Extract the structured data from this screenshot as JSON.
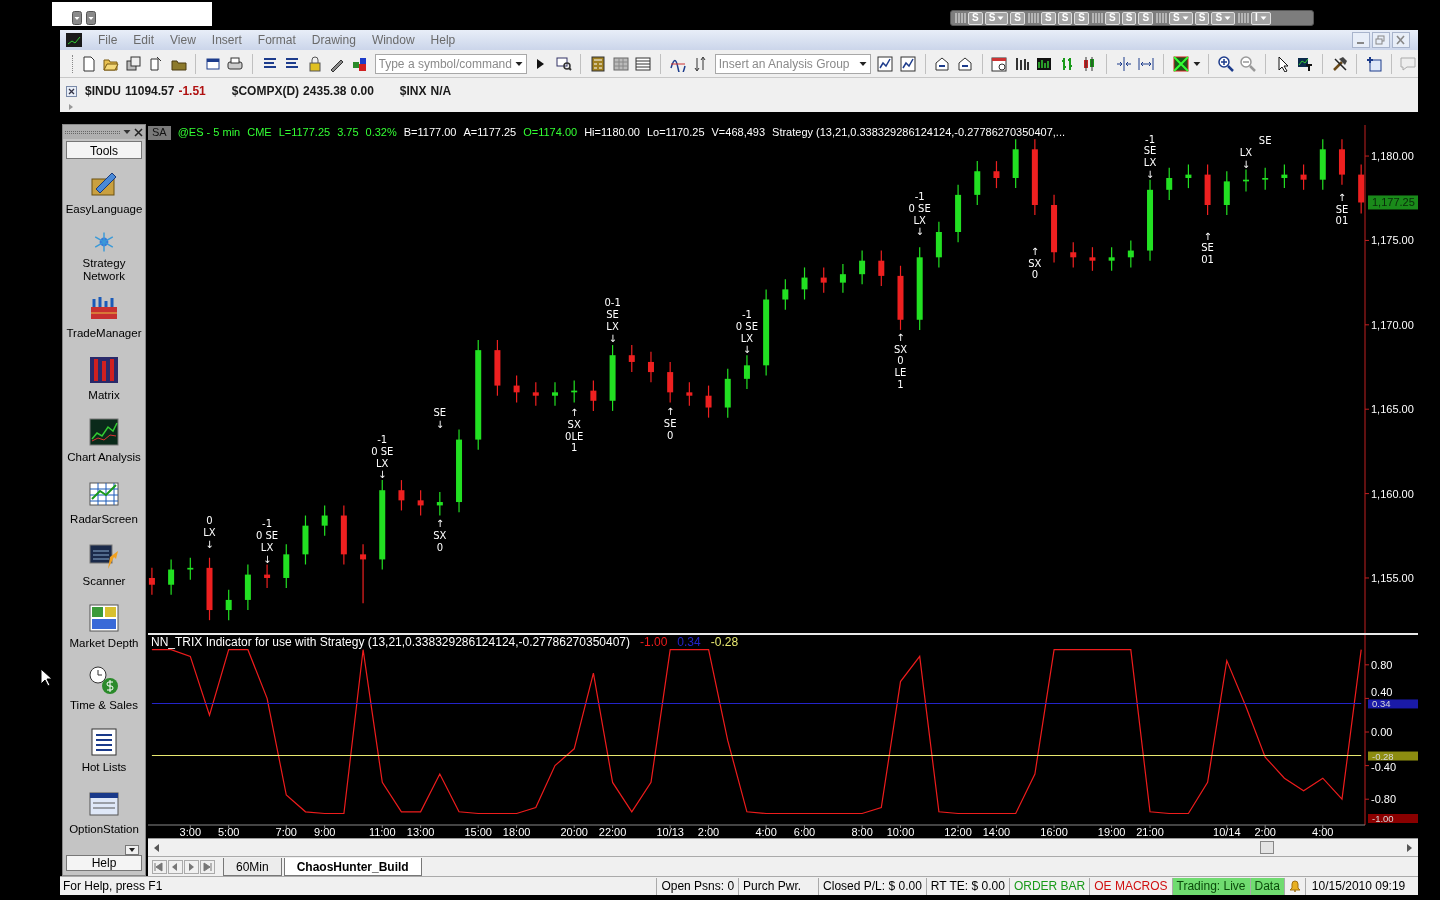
{
  "top_strip": {
    "buttons": [
      {
        "label": "S",
        "menu": false
      },
      {
        "label": "S",
        "menu": true
      },
      {
        "label": "S",
        "menu": false
      },
      {
        "label": "S",
        "menu": false
      },
      {
        "label": "S",
        "menu": false
      },
      {
        "label": "S",
        "menu": false
      },
      {
        "label": "S",
        "menu": false
      },
      {
        "label": "S",
        "menu": false
      },
      {
        "label": "S",
        "menu": false
      },
      {
        "label": "S",
        "menu": true
      },
      {
        "label": "S",
        "menu": false
      },
      {
        "label": "S",
        "menu": true
      },
      {
        "label": "I",
        "menu": true
      }
    ]
  },
  "window": {
    "menu": [
      "File",
      "Edit",
      "View",
      "Insert",
      "Format",
      "Drawing",
      "Window",
      "Help"
    ]
  },
  "toolbar": {
    "symbol_field": {
      "placeholder": "Type a symbol/command"
    },
    "analysis_field": {
      "placeholder": "Insert an Analysis Group"
    }
  },
  "quote_bar": [
    {
      "symbol": "$INDU",
      "last": "11094.57",
      "change": "-1.51",
      "color": "#b01010"
    },
    {
      "symbol": "$COMPX(D)",
      "last": "2435.38",
      "change": "0.00",
      "color": "#1a1a1a"
    },
    {
      "symbol": "$INX",
      "last": "N/A"
    }
  ],
  "tools_panel": {
    "title": "Tools",
    "items": [
      "EasyLanguage",
      "Strategy Network",
      "TradeManager",
      "Matrix",
      "Chart Analysis",
      "RadarScreen",
      "Scanner",
      "Market Depth",
      "Time & Sales",
      "Hot Lists",
      "OptionStation"
    ],
    "footer": "Help"
  },
  "chart": {
    "badge": "SA",
    "legend": [
      {
        "text": "@ES - 5 min",
        "color": "#33ff33"
      },
      {
        "text": "CME",
        "color": "#33ff33"
      },
      {
        "text": "L=1177.25",
        "color": "#33ff33"
      },
      {
        "text": "3.75",
        "color": "#33ff33"
      },
      {
        "text": "0.32%",
        "color": "#33ff33"
      },
      {
        "text": "B=1177.00",
        "color": "#ffffff"
      },
      {
        "text": "A=1177.25",
        "color": "#ffffff"
      },
      {
        "text": "O=1174.00",
        "color": "#33ff33"
      },
      {
        "text": "Hi=1180.00",
        "color": "#ffffff"
      },
      {
        "text": "Lo=1170.25",
        "color": "#ffffff"
      },
      {
        "text": "V=468,493",
        "color": "#ffffff"
      },
      {
        "text": "Strategy (13,21,0.338329286124124,-0.27786270350407,...",
        "color": "#ffffff"
      }
    ],
    "last_price_tag": "1,177.25",
    "chart_data": {
      "type": "candlestick",
      "ylim": [
        1151.74,
        1181.84
      ],
      "categories": [
        null,
        null,
        null,
        null,
        null,
        null,
        null,
        null,
        null,
        null,
        null,
        null,
        null,
        null,
        null,
        null,
        null,
        null,
        null,
        null,
        null,
        null,
        null,
        null,
        null,
        null,
        null,
        null,
        null,
        null,
        null,
        null,
        null,
        null,
        null,
        null,
        null,
        null,
        null,
        null,
        null,
        null,
        null,
        null,
        null,
        null,
        null,
        null,
        null,
        null,
        null,
        null,
        null,
        null,
        null,
        null,
        null,
        null,
        null,
        null,
        null,
        null,
        null,
        null
      ],
      "ohlc": [
        [
          1155.0,
          1155.6,
          1154.0,
          1154.6
        ],
        [
          1154.6,
          1156.1,
          1154.0,
          1155.5
        ],
        [
          1155.5,
          1156.2,
          1154.9,
          1155.6
        ],
        [
          1155.6,
          1156.2,
          1152.5,
          1153.1
        ],
        [
          1153.1,
          1154.3,
          1152.5,
          1153.7
        ],
        [
          1153.7,
          1155.8,
          1153.1,
          1155.2
        ],
        [
          1155.2,
          1155.8,
          1154.4,
          1155.0
        ],
        [
          1155.0,
          1157.0,
          1154.4,
          1156.4
        ],
        [
          1156.4,
          1158.7,
          1155.8,
          1158.1
        ],
        [
          1158.1,
          1159.3,
          1157.5,
          1158.7
        ],
        [
          1158.7,
          1159.3,
          1155.8,
          1156.4
        ],
        [
          1156.4,
          1157.0,
          1153.5,
          1156.1
        ],
        [
          1156.1,
          1160.8,
          1155.5,
          1160.2
        ],
        [
          1160.2,
          1160.8,
          1159.0,
          1159.6
        ],
        [
          1159.6,
          1160.2,
          1158.7,
          1159.3
        ],
        [
          1159.3,
          1160.1,
          1158.7,
          1159.5
        ],
        [
          1159.5,
          1163.8,
          1158.9,
          1163.2
        ],
        [
          1163.2,
          1169.1,
          1162.6,
          1168.5
        ],
        [
          1168.5,
          1169.1,
          1165.8,
          1166.4
        ],
        [
          1166.4,
          1167.0,
          1165.4,
          1166.0
        ],
        [
          1166.0,
          1166.6,
          1165.2,
          1165.8
        ],
        [
          1165.8,
          1166.6,
          1165.2,
          1166.0
        ],
        [
          1166.0,
          1166.7,
          1165.4,
          1166.1
        ],
        [
          1166.1,
          1166.7,
          1164.9,
          1165.5
        ],
        [
          1165.5,
          1168.8,
          1164.9,
          1168.2
        ],
        [
          1168.2,
          1168.8,
          1167.2,
          1167.8
        ],
        [
          1167.8,
          1168.4,
          1166.6,
          1167.2
        ],
        [
          1167.2,
          1167.8,
          1165.4,
          1166.0
        ],
        [
          1166.0,
          1166.6,
          1165.2,
          1165.8
        ],
        [
          1165.8,
          1166.4,
          1164.5,
          1165.1
        ],
        [
          1165.1,
          1167.4,
          1164.5,
          1166.8
        ],
        [
          1166.8,
          1168.2,
          1166.2,
          1167.6
        ],
        [
          1167.6,
          1172.1,
          1167.0,
          1171.5
        ],
        [
          1171.5,
          1172.7,
          1170.9,
          1172.1
        ],
        [
          1172.1,
          1173.4,
          1171.5,
          1172.8
        ],
        [
          1172.8,
          1173.4,
          1171.9,
          1172.5
        ],
        [
          1172.5,
          1173.6,
          1171.9,
          1173.0
        ],
        [
          1173.0,
          1174.4,
          1172.4,
          1173.8
        ],
        [
          1173.8,
          1174.4,
          1172.3,
          1172.9
        ],
        [
          1172.9,
          1173.5,
          1169.7,
          1170.3
        ],
        [
          1170.3,
          1174.6,
          1169.7,
          1174.0
        ],
        [
          1174.0,
          1176.1,
          1173.4,
          1175.5
        ],
        [
          1175.5,
          1178.3,
          1174.9,
          1177.7
        ],
        [
          1177.7,
          1179.7,
          1177.1,
          1179.1
        ],
        [
          1179.1,
          1179.7,
          1178.1,
          1178.7
        ],
        [
          1178.7,
          1181.0,
          1178.1,
          1180.4
        ],
        [
          1180.4,
          1181.0,
          1176.5,
          1177.1
        ],
        [
          1177.1,
          1177.7,
          1173.7,
          1174.3
        ],
        [
          1174.3,
          1174.9,
          1173.4,
          1174.0
        ],
        [
          1174.0,
          1174.6,
          1173.2,
          1173.8
        ],
        [
          1173.8,
          1174.6,
          1173.2,
          1174.0
        ],
        [
          1174.0,
          1175.0,
          1173.4,
          1174.4
        ],
        [
          1174.4,
          1178.6,
          1173.8,
          1178.0
        ],
        [
          1178.0,
          1179.3,
          1177.4,
          1178.7
        ],
        [
          1178.7,
          1179.5,
          1178.1,
          1178.9
        ],
        [
          1178.9,
          1179.5,
          1176.5,
          1177.1
        ],
        [
          1177.1,
          1179.1,
          1176.5,
          1178.5
        ],
        [
          1178.5,
          1179.2,
          1177.9,
          1178.6
        ],
        [
          1178.6,
          1179.3,
          1178.0,
          1178.7
        ],
        [
          1178.7,
          1179.5,
          1178.1,
          1178.9
        ],
        [
          1178.9,
          1179.5,
          1178.0,
          1178.6
        ],
        [
          1178.6,
          1181.0,
          1178.0,
          1180.4
        ],
        [
          1180.4,
          1181.0,
          1178.3,
          1178.9
        ],
        [
          1178.9,
          1179.5,
          1176.6,
          1177.25
        ]
      ],
      "yticks": [
        {
          "value": 1155,
          "label": "1,155.00"
        },
        {
          "value": 1160,
          "label": "1,160.00"
        },
        {
          "value": 1165,
          "label": "1,165.00"
        },
        {
          "value": 1170,
          "label": "1,170.00"
        },
        {
          "value": 1175,
          "label": "1,175.00"
        },
        {
          "value": 1180,
          "label": "1,180.00"
        }
      ]
    },
    "signals": [
      {
        "lines": [
          "0",
          "LX",
          "↓"
        ]
      },
      {
        "lines": [
          "-1",
          "0 SE",
          "LX",
          "↓"
        ]
      },
      {
        "lines": [
          "-1",
          "0 SE",
          "LX",
          "↓"
        ]
      },
      {
        "lines": [
          "SE",
          "↓"
        ]
      },
      {
        "lines": [
          "↑",
          "SX",
          "0"
        ]
      },
      {
        "lines": [
          "↑",
          "SX",
          "0LE",
          "1"
        ]
      },
      {
        "lines": [
          "0-1",
          "SE",
          "LX",
          "↓"
        ]
      },
      {
        "lines": [
          "↑",
          "SE",
          "0"
        ]
      },
      {
        "lines": [
          "-1",
          "0 SE",
          "LX",
          "↓"
        ]
      },
      {
        "lines": [
          "↑",
          "SX",
          "0",
          "LE",
          "1"
        ]
      },
      {
        "lines": [
          "-1",
          "0 SE",
          "LX",
          "↓"
        ]
      },
      {
        "lines": [
          "↑",
          "SX",
          "0"
        ]
      },
      {
        "lines": [
          "-1",
          "SE",
          "LX",
          "↓"
        ]
      },
      {
        "lines": [
          "↑",
          "SE",
          "01"
        ]
      },
      {
        "lines": [
          "LX",
          "↓"
        ]
      },
      {
        "lines": [
          "SE"
        ]
      },
      {
        "lines": [
          "↑",
          "SE",
          "01"
        ]
      }
    ]
  },
  "indicator": {
    "legend": [
      {
        "text": "NN_TRIX Indicator for use with Strategy (13,21,0.338329286124124,-0.27786270350407)"
      },
      {
        "text": "-1.00"
      },
      {
        "text": "0.34"
      },
      {
        "text": "-0.28"
      }
    ],
    "tags": [
      {
        "text": "0.34",
        "color": "#1a1aa8"
      },
      {
        "text": "-0.28",
        "color": "#8c8c10"
      },
      {
        "text": "-1.00",
        "color": "#8a0000"
      }
    ],
    "chart_data": {
      "type": "line",
      "ylim": [
        -1.107,
        1.155
      ],
      "categories": [
        null,
        null,
        "3:00",
        null,
        "5:00",
        null,
        null,
        "7:00",
        null,
        "9:00",
        null,
        null,
        "11:00",
        null,
        "13:00",
        null,
        null,
        "15:00",
        null,
        "18:00",
        null,
        null,
        "20:00",
        null,
        "22:00",
        null,
        null,
        "10/13",
        null,
        "2:00",
        null,
        null,
        "4:00",
        null,
        "6:00",
        null,
        null,
        "8:00",
        null,
        "10:00",
        null,
        null,
        "12:00",
        null,
        "14:00",
        null,
        null,
        "16:00",
        null,
        null,
        "19:00",
        null,
        "21:00",
        null,
        null,
        null,
        "10/14",
        null,
        "2:00",
        null,
        null,
        "4:00",
        null,
        null
      ],
      "series": [
        {
          "color": "#ee1c1c",
          "values": [
            0.98,
            0.98,
            0.9,
            0.2,
            0.98,
            0.98,
            0.4,
            -0.75,
            -0.95,
            -0.97,
            -0.97,
            0.98,
            -0.6,
            -0.95,
            -0.95,
            -0.5,
            -0.95,
            -0.97,
            -0.97,
            -0.97,
            -0.9,
            -0.4,
            -0.2,
            0.7,
            -0.6,
            -0.95,
            -0.6,
            0.98,
            0.98,
            0.98,
            -0.1,
            -0.95,
            -0.97,
            -0.97,
            -0.97,
            -0.97,
            -0.97,
            -0.97,
            -0.9,
            0.6,
            0.9,
            -0.95,
            -0.97,
            -0.97,
            -0.97,
            -0.97,
            -0.5,
            0.98,
            0.98,
            0.98,
            0.98,
            0.98,
            -0.95,
            -0.97,
            -0.97,
            -0.6,
            0.85,
            0.3,
            -0.3,
            -0.55,
            -0.7,
            -0.55,
            -0.8,
            0.98
          ]
        },
        {
          "color": "#2424c8",
          "values": [
            0.34,
            0.34,
            0.34,
            0.34,
            0.34,
            0.34,
            0.34,
            0.34,
            0.34,
            0.34,
            0.34,
            0.34,
            0.34,
            0.34,
            0.34,
            0.34,
            0.34,
            0.34,
            0.34,
            0.34,
            0.34,
            0.34,
            0.34,
            0.34,
            0.34,
            0.34,
            0.34,
            0.34,
            0.34,
            0.34,
            0.34,
            0.34,
            0.34,
            0.34,
            0.34,
            0.34,
            0.34,
            0.34,
            0.34,
            0.34,
            0.34,
            0.34,
            0.34,
            0.34,
            0.34,
            0.34,
            0.34,
            0.34,
            0.34,
            0.34,
            0.34,
            0.34,
            0.34,
            0.34,
            0.34,
            0.34,
            0.34,
            0.34,
            0.34,
            0.34,
            0.34,
            0.34,
            0.34,
            0.34
          ]
        },
        {
          "color": "#e8e870",
          "values": [
            -0.28,
            -0.28,
            -0.28,
            -0.28,
            -0.28,
            -0.28,
            -0.28,
            -0.28,
            -0.28,
            -0.28,
            -0.28,
            -0.28,
            -0.28,
            -0.28,
            -0.28,
            -0.28,
            -0.28,
            -0.28,
            -0.28,
            -0.28,
            -0.28,
            -0.28,
            -0.28,
            -0.28,
            -0.28,
            -0.28,
            -0.28,
            -0.28,
            -0.28,
            -0.28,
            -0.28,
            -0.28,
            -0.28,
            -0.28,
            -0.28,
            -0.28,
            -0.28,
            -0.28,
            -0.28,
            -0.28,
            -0.28,
            -0.28,
            -0.28,
            -0.28,
            -0.28,
            -0.28,
            -0.28,
            -0.28,
            -0.28,
            -0.28,
            -0.28,
            -0.28,
            -0.28,
            -0.28,
            -0.28,
            -0.28,
            -0.28,
            -0.28,
            -0.28,
            -0.28,
            -0.28,
            -0.28,
            -0.28,
            -0.28
          ]
        }
      ],
      "yticks": [
        {
          "value": 0.8,
          "label": "0.80"
        },
        {
          "value": 0.4,
          "label": "0.40"
        },
        {
          "value": 0,
          "label": "0.00"
        },
        {
          "value": -0.4,
          "label": "-0.40"
        },
        {
          "value": -0.8,
          "label": "-0.80"
        }
      ]
    }
  },
  "tabs": [
    {
      "label": "60Min",
      "selected": false
    },
    {
      "label": "ChaosHunter_Build",
      "selected": true
    }
  ],
  "status_bar": {
    "help": "For Help, press F1",
    "fields": [
      {
        "text": "Open Psns: 0",
        "kind": "plain"
      },
      {
        "text": "Purch Pwr.",
        "kind": "plain"
      },
      {
        "text": "Closed P/L: $ 0.00",
        "kind": "plain"
      },
      {
        "text": "RT TE: $ 0.00",
        "kind": "plain"
      },
      {
        "text": "ORDER BAR",
        "kind": "ok"
      },
      {
        "text": "OE MACROS",
        "kind": "alert"
      },
      {
        "text": "Trading: Live",
        "kind": "live"
      },
      {
        "text": "Data",
        "kind": "live"
      }
    ],
    "time": "10/15/2010 09:19"
  }
}
